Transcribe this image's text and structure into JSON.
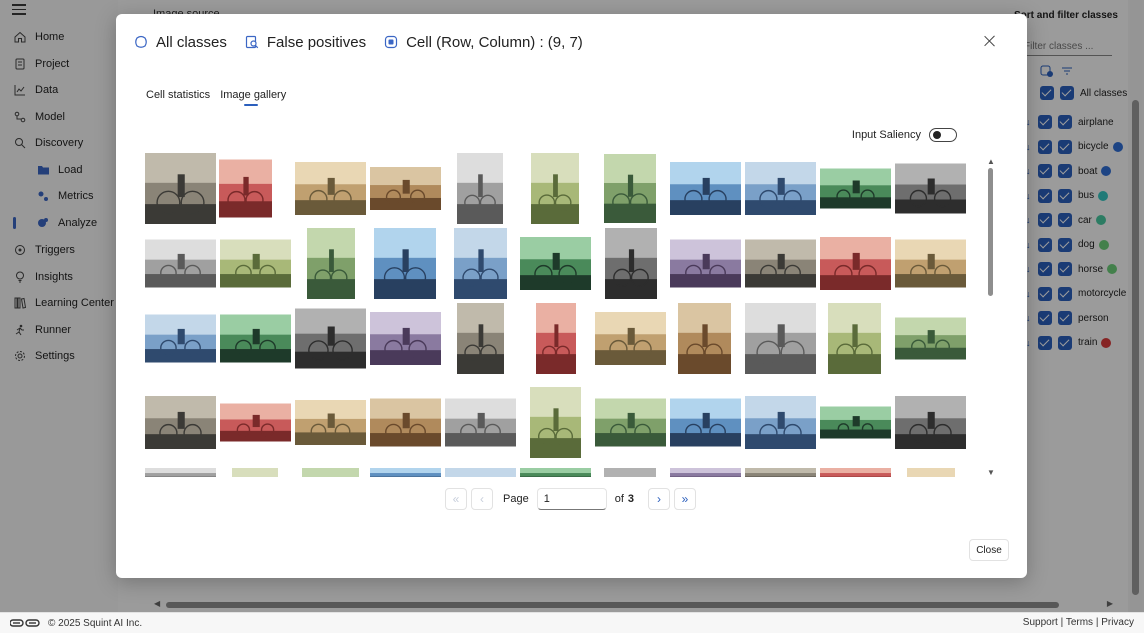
{
  "sidebar": {
    "items": [
      {
        "label": "Home",
        "icon": "home-icon"
      },
      {
        "label": "Project",
        "icon": "project-icon"
      },
      {
        "label": "Data",
        "icon": "data-icon"
      },
      {
        "label": "Model",
        "icon": "model-icon"
      },
      {
        "label": "Discovery",
        "icon": "discovery-icon"
      },
      {
        "label": "Load",
        "icon": "folder-icon"
      },
      {
        "label": "Metrics",
        "icon": "metrics-icon"
      },
      {
        "label": "Analyze",
        "icon": "analyze-icon"
      },
      {
        "label": "Triggers",
        "icon": "triggers-icon"
      },
      {
        "label": "Insights",
        "icon": "lightbulb-icon"
      },
      {
        "label": "Learning Center",
        "icon": "library-icon"
      },
      {
        "label": "Runner",
        "icon": "runner-icon"
      },
      {
        "label": "Settings",
        "icon": "gear-icon"
      }
    ]
  },
  "main": {
    "heading": "Image source"
  },
  "class_panel": {
    "title": "Sort and filter classes",
    "filter_placeholder": "Filter classes ...",
    "all_label": "All classes",
    "classes": [
      {
        "name": "airplane",
        "color": ""
      },
      {
        "name": "bicycle",
        "color": "#2f6fd6"
      },
      {
        "name": "boat",
        "color": "#2f6fd6"
      },
      {
        "name": "bus",
        "color": "#34c6c0"
      },
      {
        "name": "car",
        "color": "#48c9a0"
      },
      {
        "name": "dog",
        "color": "#6ccf7a"
      },
      {
        "name": "horse",
        "color": "#6ccf7a"
      },
      {
        "name": "motorcycle",
        "color": ""
      },
      {
        "name": "person",
        "color": ""
      },
      {
        "name": "train",
        "color": "#d93a3a"
      }
    ]
  },
  "modal": {
    "title_class": "All classes",
    "title_type": "False positives",
    "title_cell": "Cell (Row, Column) : (9, 7)",
    "tabs": [
      {
        "label": "Cell statistics",
        "active": false
      },
      {
        "label": "Image gallery",
        "active": true
      }
    ],
    "saliency_label": "Input Saliency",
    "pager": {
      "page_label": "Page",
      "page_value": "1",
      "of_label": "of",
      "total": "3"
    },
    "close_label": "Close"
  },
  "footer": {
    "copyright": "© 2025 Squint AI Inc.",
    "links": [
      "Support",
      "Terms",
      "Privacy"
    ]
  }
}
